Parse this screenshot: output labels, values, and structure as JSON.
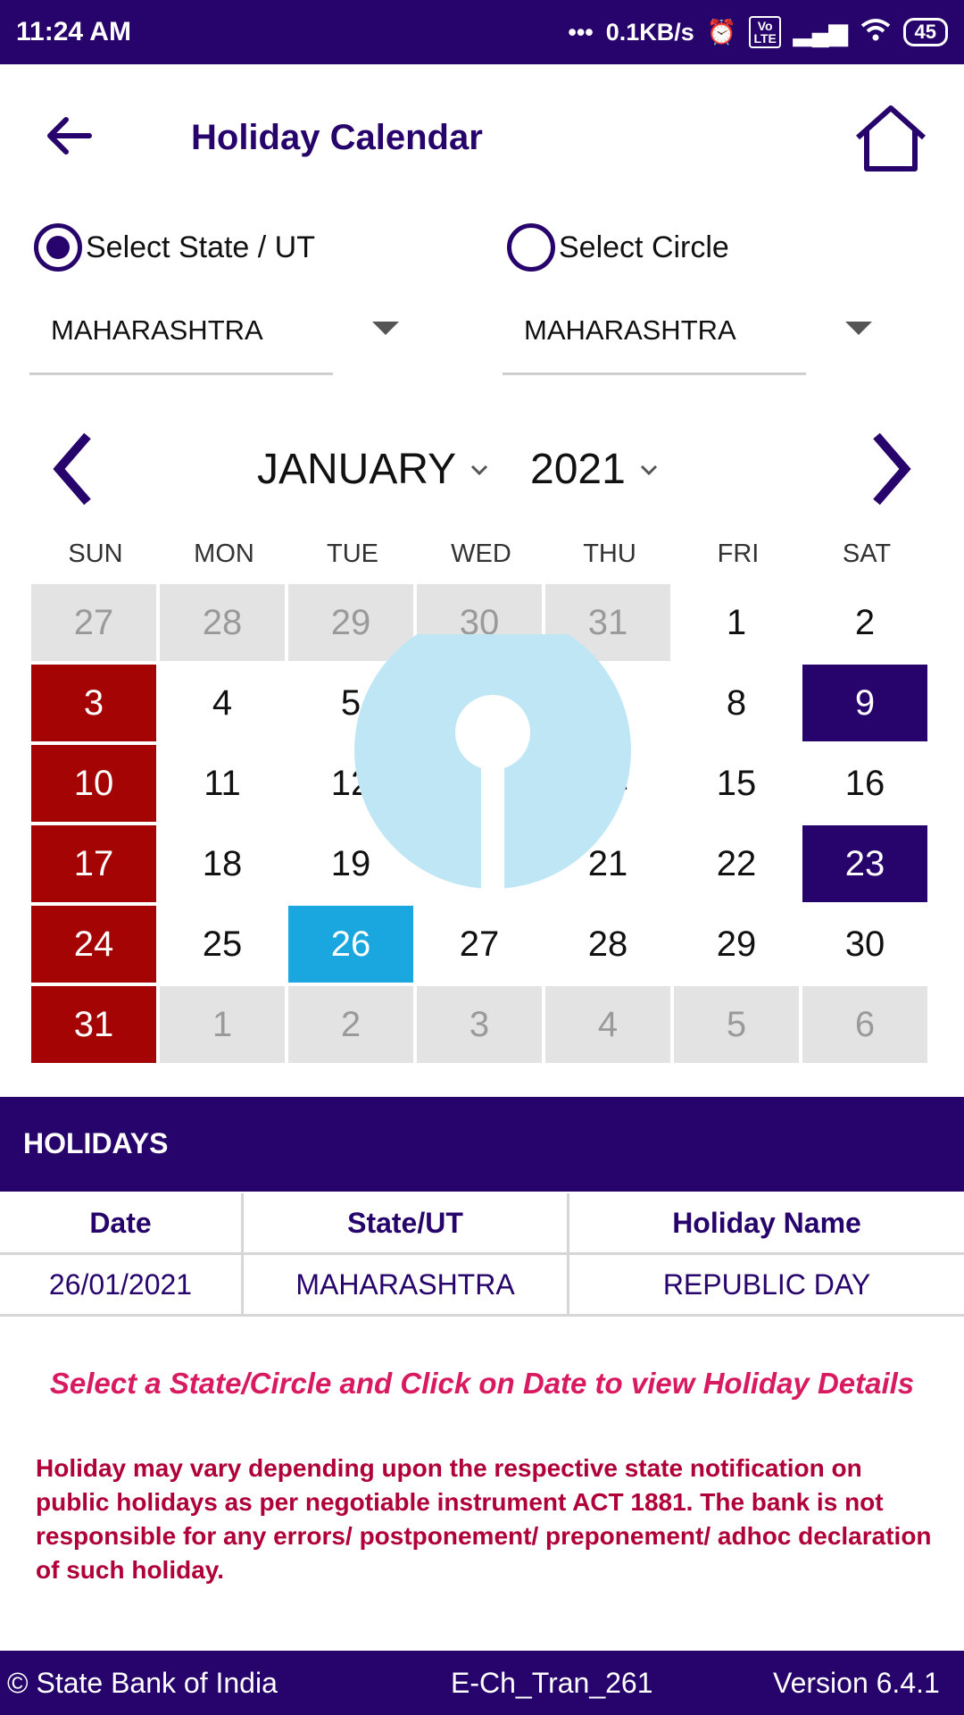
{
  "status_bar": {
    "time": "11:24 AM",
    "net_speed": "0.1KB/s",
    "volte": "Vo\nLTE",
    "battery": "45"
  },
  "header": {
    "title": "Holiday Calendar",
    "back_icon": "arrow-left-icon",
    "home_icon": "home-icon"
  },
  "filters": {
    "state_radio_label": "Select State / UT",
    "circle_radio_label": "Select Circle",
    "selected_mode": "state",
    "state_value": "MAHARASHTRA",
    "circle_value": "MAHARASHTRA"
  },
  "calendar": {
    "month": "JANUARY",
    "year": "2021",
    "weekdays": [
      "SUN",
      "MON",
      "TUE",
      "WED",
      "THU",
      "FRI",
      "SAT"
    ],
    "days": [
      {
        "d": "27",
        "t": "other"
      },
      {
        "d": "28",
        "t": "other"
      },
      {
        "d": "29",
        "t": "other"
      },
      {
        "d": "30",
        "t": "other"
      },
      {
        "d": "31",
        "t": "other"
      },
      {
        "d": "1",
        "t": "normal"
      },
      {
        "d": "2",
        "t": "normal"
      },
      {
        "d": "3",
        "t": "sun"
      },
      {
        "d": "4",
        "t": "normal"
      },
      {
        "d": "5",
        "t": "normal"
      },
      {
        "d": "6",
        "t": "normal"
      },
      {
        "d": "7",
        "t": "normal"
      },
      {
        "d": "8",
        "t": "normal"
      },
      {
        "d": "9",
        "t": "sat-hol"
      },
      {
        "d": "10",
        "t": "sun"
      },
      {
        "d": "11",
        "t": "normal"
      },
      {
        "d": "12",
        "t": "normal"
      },
      {
        "d": "13",
        "t": "normal"
      },
      {
        "d": "14",
        "t": "normal"
      },
      {
        "d": "15",
        "t": "normal"
      },
      {
        "d": "16",
        "t": "normal"
      },
      {
        "d": "17",
        "t": "sun"
      },
      {
        "d": "18",
        "t": "normal"
      },
      {
        "d": "19",
        "t": "normal"
      },
      {
        "d": "20",
        "t": "normal"
      },
      {
        "d": "21",
        "t": "normal"
      },
      {
        "d": "22",
        "t": "normal"
      },
      {
        "d": "23",
        "t": "sat-hol"
      },
      {
        "d": "24",
        "t": "sun"
      },
      {
        "d": "25",
        "t": "normal"
      },
      {
        "d": "26",
        "t": "today"
      },
      {
        "d": "27",
        "t": "normal"
      },
      {
        "d": "28",
        "t": "normal"
      },
      {
        "d": "29",
        "t": "normal"
      },
      {
        "d": "30",
        "t": "normal"
      },
      {
        "d": "31",
        "t": "sun"
      },
      {
        "d": "1",
        "t": "other"
      },
      {
        "d": "2",
        "t": "other"
      },
      {
        "d": "3",
        "t": "other"
      },
      {
        "d": "4",
        "t": "other"
      },
      {
        "d": "5",
        "t": "other"
      },
      {
        "d": "6",
        "t": "other"
      }
    ],
    "colors": {
      "sunday": "#a50404",
      "saturday_holiday": "#27046c",
      "selected": "#1aa6df",
      "other_month": "#e3e3e3"
    }
  },
  "holidays": {
    "heading": "HOLIDAYS",
    "columns": [
      "Date",
      "State/UT",
      "Holiday Name"
    ],
    "rows": [
      [
        "26/01/2021",
        "MAHARASHTRA",
        "REPUBLIC DAY"
      ]
    ]
  },
  "hint": "Select a State/Circle and Click on Date to view Holiday Details",
  "disclaimer": "Holiday may vary depending upon the respective state notification on public holidays as per negotiable instrument ACT 1881. The bank is not responsible for any errors/ postponement/ preponement/ adhoc declaration of such holiday.",
  "footer": {
    "copyright": "© State Bank of India",
    "code": "E-Ch_Tran_261",
    "version": "Version  6.4.1"
  },
  "theme": {
    "primary": "#27046c",
    "accent_pink": "#d81b60",
    "disclaimer_red": "#b0003a"
  }
}
